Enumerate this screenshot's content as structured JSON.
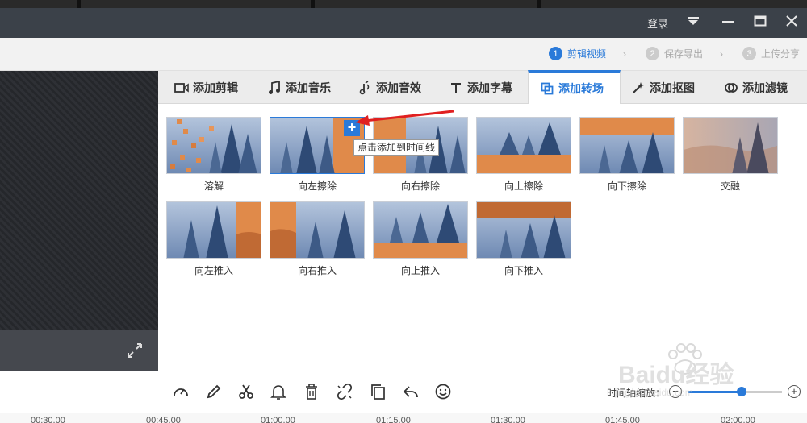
{
  "titlebar": {
    "login": "登录"
  },
  "steps": [
    {
      "num": "1",
      "label": "剪辑视频",
      "active": true
    },
    {
      "num": "2",
      "label": "保存导出",
      "active": false
    },
    {
      "num": "3",
      "label": "上传分享",
      "active": false
    }
  ],
  "tabs": [
    {
      "label": "添加剪辑",
      "icon": "video-camera-icon"
    },
    {
      "label": "添加音乐",
      "icon": "music-note-icon"
    },
    {
      "label": "添加音效",
      "icon": "sound-effect-icon"
    },
    {
      "label": "添加字幕",
      "icon": "text-icon"
    },
    {
      "label": "添加转场",
      "icon": "transition-icon",
      "active": true
    },
    {
      "label": "添加抠图",
      "icon": "magic-wand-icon"
    },
    {
      "label": "添加滤镜",
      "icon": "filter-icon"
    }
  ],
  "transitions": [
    {
      "label": "溶解"
    },
    {
      "label": "向左擦除",
      "selected": true
    },
    {
      "label": "向右擦除"
    },
    {
      "label": "向上擦除"
    },
    {
      "label": "向下擦除"
    },
    {
      "label": "交融"
    },
    {
      "label": "向左推入"
    },
    {
      "label": "向右推入"
    },
    {
      "label": "向上推入"
    },
    {
      "label": "向下推入"
    }
  ],
  "tooltip": {
    "add_to_timeline": "点击添加到时间线"
  },
  "toolbar": {
    "zoom_label": "时间轴缩放：",
    "zoom_level": 0.57,
    "tools": [
      "speed-icon",
      "pencil-icon",
      "scissors-icon",
      "bell-icon",
      "trash-icon",
      "unlink-icon",
      "copy-icon",
      "undo-icon",
      "emoji-icon"
    ]
  },
  "timeline": {
    "ticks": [
      "00:30.00",
      "00:45.00",
      "01:00.00",
      "01:15.00",
      "01:30.00",
      "01:45.00",
      "02:00.00"
    ]
  },
  "watermark": {
    "text": "Baidu经验",
    "subtext": "jingyan.baidu.com"
  }
}
